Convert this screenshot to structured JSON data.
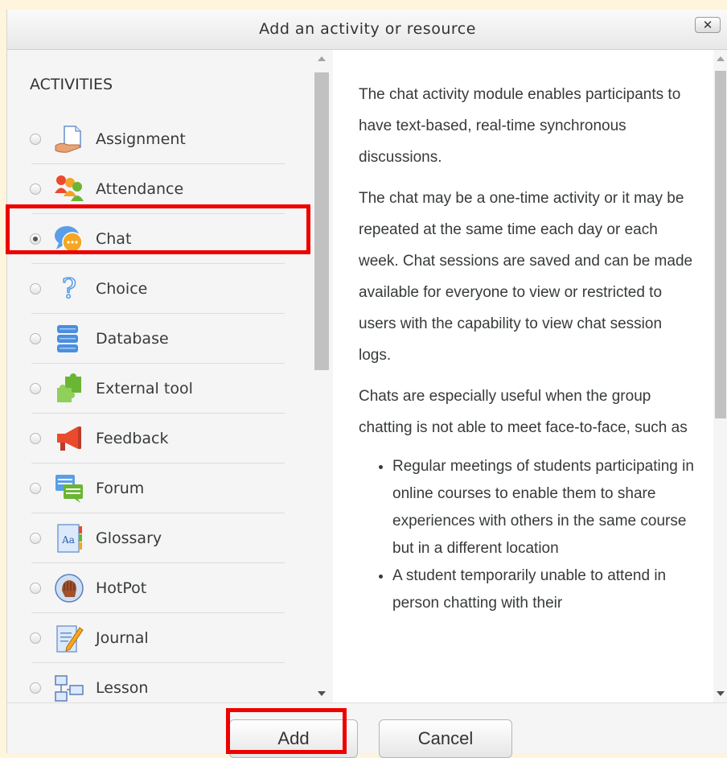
{
  "dialog": {
    "title": "Add an activity or resource",
    "close_label": "✕"
  },
  "activities": {
    "header": "ACTIVITIES",
    "items": [
      {
        "label": "Assignment",
        "icon": "assignment-icon",
        "selected": false
      },
      {
        "label": "Attendance",
        "icon": "attendance-icon",
        "selected": false
      },
      {
        "label": "Chat",
        "icon": "chat-icon",
        "selected": true
      },
      {
        "label": "Choice",
        "icon": "choice-icon",
        "selected": false
      },
      {
        "label": "Database",
        "icon": "database-icon",
        "selected": false
      },
      {
        "label": "External tool",
        "icon": "external-tool-icon",
        "selected": false
      },
      {
        "label": "Feedback",
        "icon": "feedback-icon",
        "selected": false
      },
      {
        "label": "Forum",
        "icon": "forum-icon",
        "selected": false
      },
      {
        "label": "Glossary",
        "icon": "glossary-icon",
        "selected": false
      },
      {
        "label": "HotPot",
        "icon": "hotpot-icon",
        "selected": false
      },
      {
        "label": "Journal",
        "icon": "journal-icon",
        "selected": false
      },
      {
        "label": "Lesson",
        "icon": "lesson-icon",
        "selected": false
      }
    ]
  },
  "description": {
    "paragraphs": [
      "The chat activity module enables participants to have text-based, real-time synchronous discussions.",
      "The chat may be a one-time activity or it may be repeated at the same time each day or each week. Chat sessions are saved and can be made available for everyone to view or restricted to users with the capability to view chat session logs.",
      "Chats are especially useful when the group chatting is not able to meet face-to-face, such as"
    ],
    "bullets": [
      "Regular meetings of students participating in online courses to enable them to share experiences with others in the same course but in a different location",
      "A student temporarily unable to attend in person chatting with their"
    ]
  },
  "footer": {
    "add_label": "Add",
    "cancel_label": "Cancel"
  },
  "colors": {
    "highlight": "#ee0000",
    "page_background": "#fff4dc"
  }
}
